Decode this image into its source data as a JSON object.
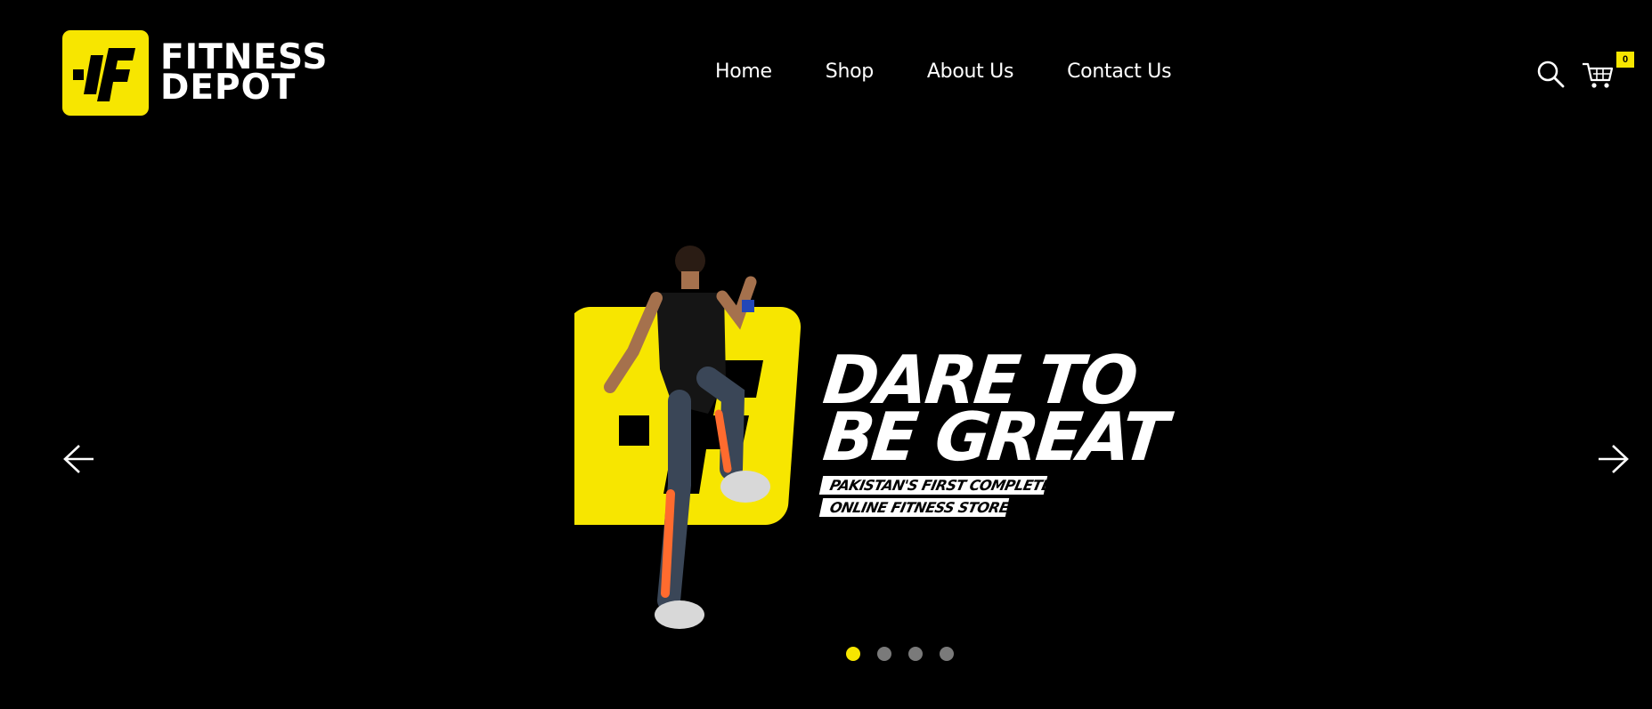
{
  "brand": {
    "logo_line1": "FITNESS",
    "logo_line2": "DEPOT",
    "accent_color": "#f7e600"
  },
  "nav": {
    "items": [
      {
        "label": "Home"
      },
      {
        "label": "Shop"
      },
      {
        "label": "About Us"
      },
      {
        "label": "Contact Us"
      }
    ]
  },
  "tools": {
    "search_icon": "search-icon",
    "cart_icon": "cart-icon",
    "cart_count": "0"
  },
  "hero": {
    "title_line1": "DARE TO",
    "title_line2": "BE GREAT",
    "tagline_line1": "PAKISTAN'S FIRST COMPLETE",
    "tagline_line2": "ONLINE FITNESS STORE",
    "prev_icon": "arrow-left-icon",
    "next_icon": "arrow-right-icon",
    "slides_total": 4,
    "active_slide": 1
  }
}
